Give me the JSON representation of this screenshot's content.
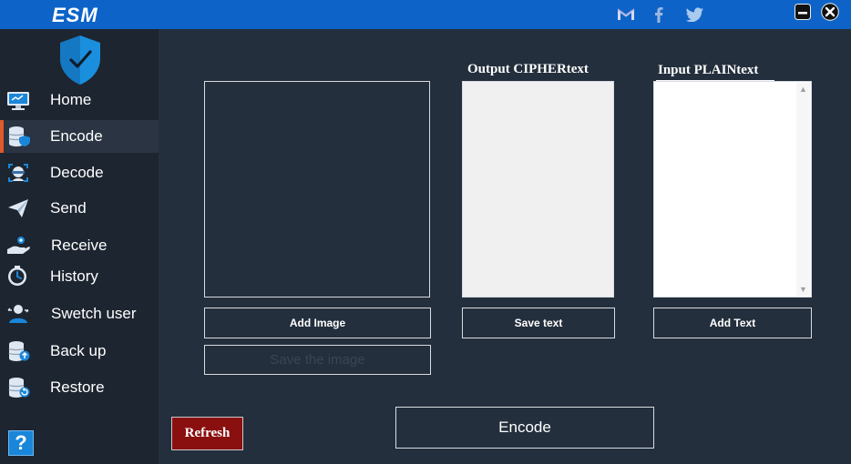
{
  "app": {
    "title": "ESM"
  },
  "titlebar": {
    "social_icons": [
      "gmail-icon",
      "facebook-icon",
      "twitter-icon"
    ],
    "window_buttons": [
      "minimize-icon",
      "close-icon"
    ]
  },
  "sidebar": {
    "logo_icon": "shield-check-icon",
    "active_item": "Encode",
    "items": [
      {
        "label": "Home",
        "icon": "monitor-icon"
      },
      {
        "label": "Encode",
        "icon": "database-shield-icon"
      },
      {
        "label": "Decode",
        "icon": "face-scan-icon"
      },
      {
        "label": "Send",
        "icon": "paper-plane-icon"
      },
      {
        "label": "Receive",
        "icon": "hand-receive-icon"
      },
      {
        "label": "History",
        "icon": "clock-icon"
      },
      {
        "label": "Swetch user",
        "icon": "user-switch-icon"
      },
      {
        "label": "Back up",
        "icon": "database-backup-icon"
      },
      {
        "label": "Restore",
        "icon": "database-restore-icon"
      }
    ],
    "help_label": "?"
  },
  "main": {
    "cipher_label": "Output CIPHERtext",
    "plain_label": "Input PLAINtext",
    "add_image_label": "Add Image",
    "save_image_label": "Save the image",
    "save_text_label": "Save text",
    "add_text_label": "Add Text",
    "encode_label": "Encode",
    "refresh_label": "Refresh"
  },
  "colors": {
    "titlebar": "#0d63c7",
    "sidebar": "#1d2530",
    "main": "#242f3d",
    "active_marker": "#e05a2b",
    "refresh": "#8a0f0f",
    "help": "#1a86d9"
  }
}
